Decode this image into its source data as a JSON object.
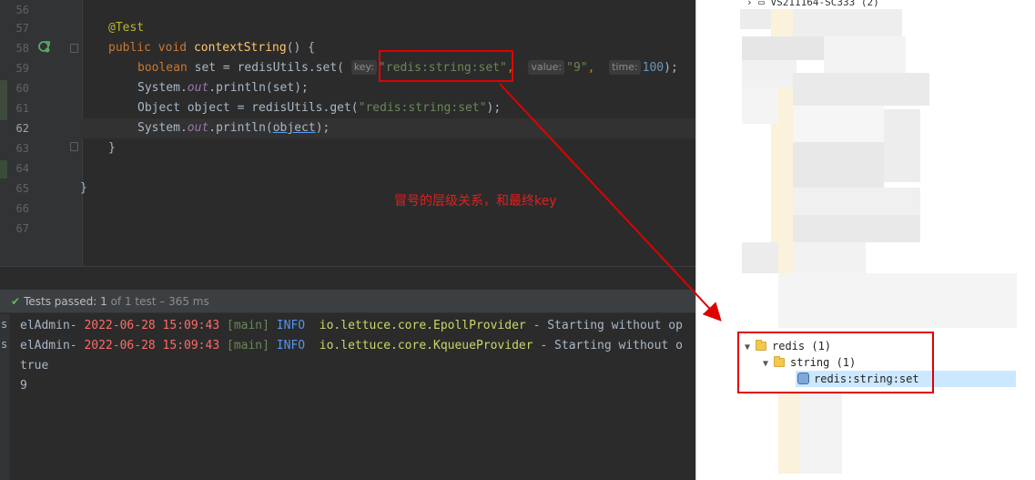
{
  "editor": {
    "line_numbers": [
      "56",
      "57",
      "58",
      "59",
      "60",
      "61",
      "62",
      "63",
      "64",
      "65",
      "66",
      "67"
    ],
    "current_line": "62",
    "annotation": "@Test",
    "method": {
      "kw_public": "public",
      "kw_void": "void",
      "name": "contextString",
      "rest": "() {"
    },
    "line59": {
      "kw": "boolean",
      "var": " set = redisUtils.set(",
      "hint_key": "key:",
      "arg_key": "\"redis:string:set\"",
      "comma1": ",",
      "hint_value": "value:",
      "arg_value": "\"9\"",
      "comma2": ",",
      "hint_time": "time:",
      "arg_time": "100",
      "end": ");"
    },
    "line60": {
      "pre": "System.",
      "field": "out",
      "post": ".println(set);"
    },
    "line61": {
      "pre": "Object object = redisUtils.get(",
      "arg": "\"redis:string:set\"",
      "post": ");"
    },
    "line62": {
      "pre": "System.",
      "field": "out",
      "mid": ".println(",
      "link": "object",
      "post": ");"
    },
    "line63": "}",
    "line65": "}"
  },
  "annotation_note": "冒号的层级关系，和最终key",
  "test_status": {
    "label": "Tests passed:",
    "count": "1",
    "detail": "of 1 test – 365 ms"
  },
  "console": {
    "lines": [
      {
        "marker": "s",
        "app": "elAdmin-",
        "timestamp": "2022-06-28 15:09:43",
        "thread": "[main]",
        "level": "INFO",
        "logger": "io.lettuce.core.EpollProvider",
        "message": " - Starting without op"
      },
      {
        "marker": "s",
        "app": "elAdmin-",
        "timestamp": "2022-06-28 15:09:43",
        "thread": "[main]",
        "level": "INFO",
        "logger": "io.lettuce.core.KqueueProvider",
        "message": " - Starting without o"
      }
    ],
    "output1": "true",
    "output2": "9"
  },
  "tree": {
    "top_partial": "VS211164-SC333 (2)",
    "redis": "redis (1)",
    "string": "string (1)",
    "key": "redis:string:set"
  },
  "colors": {
    "accent_red": "#e00000",
    "pass_green": "#5fb760",
    "selection": "#cce8ff"
  }
}
